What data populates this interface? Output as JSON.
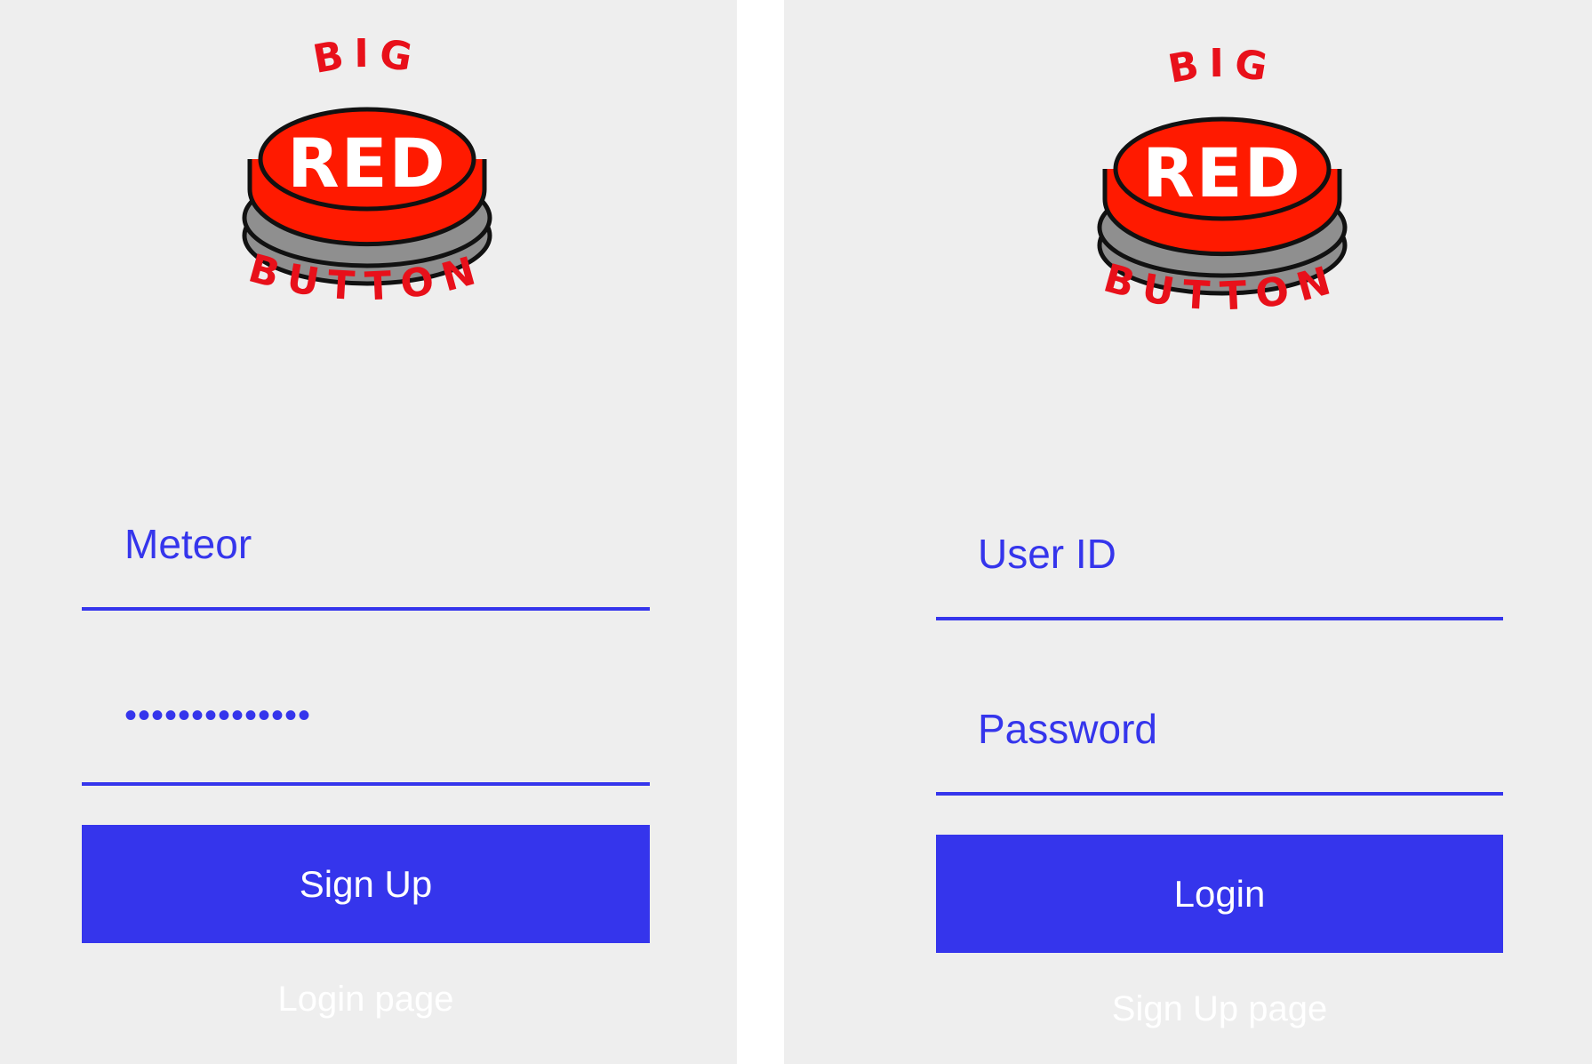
{
  "colors": {
    "accent": "#3535ec",
    "panel_background": "#eeeeee",
    "gutter": "#ffffff",
    "link_text": "#ffffff",
    "logo_red": "#ff1a00",
    "logo_text_red": "#e8101a",
    "logo_gray": "#8f8f8f"
  },
  "logo": {
    "top_text": "BIG",
    "center_text": "RED",
    "bottom_text": "BUTTON",
    "icon": "big-red-button-logo"
  },
  "signup": {
    "username_value": "Meteor",
    "password_masked": "••••••••••••••",
    "submit_label": "Sign Up",
    "link_label": "Login page"
  },
  "login": {
    "username_placeholder": "User ID",
    "password_placeholder": "Password",
    "submit_label": "Login",
    "link_label": "Sign Up page"
  }
}
